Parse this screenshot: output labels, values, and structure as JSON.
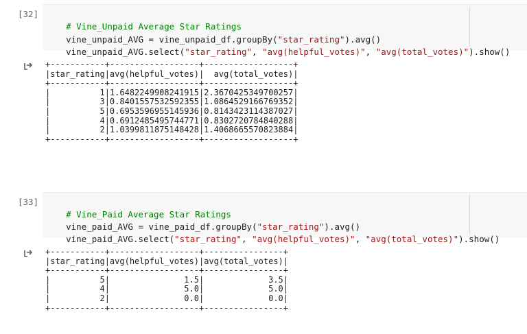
{
  "cells": [
    {
      "exec_count": "[32]",
      "code": {
        "comment": "# Vine_Unpaid Average Star Ratings",
        "line2_a": "vine_unpaid_AVG = vine_unpaid_df.groupBy(",
        "line2_str": "\"star_rating\"",
        "line2_b": ").avg()",
        "line3_a": "vine_unpaid_AVG.select(",
        "line3_s1": "\"star_rating\"",
        "line3_sep1": ", ",
        "line3_s2": "\"avg(helpful_votes)\"",
        "line3_sep2": ", ",
        "line3_s3": "\"avg(total_votes)\"",
        "line3_b": ").show()"
      },
      "output": {
        "icon": "output-arrow-icon",
        "table": {
          "columns": [
            "star_rating",
            "avg(helpful_votes)",
            "avg(total_votes)"
          ],
          "rows": [
            [
              "1",
              "1.6482249908241915",
              "2.3670425349700257"
            ],
            [
              "3",
              "0.8401557532592355",
              "1.0864529166769352"
            ],
            [
              "5",
              "0.6953596955145936",
              "0.8143423114387027"
            ],
            [
              "4",
              "0.6912485495744771",
              "0.8302720784840288"
            ],
            [
              "2",
              "1.0399811875148428",
              "1.4068665570823884"
            ]
          ]
        }
      }
    },
    {
      "exec_count": "[33]",
      "code": {
        "comment": "# Vine_Paid Average Star Ratings",
        "line2_a": "vine_paid_AVG = vine_paid_df.groupBy(",
        "line2_str": "\"star_rating\"",
        "line2_b": ").avg()",
        "line3_a": "vine_paid_AVG.select(",
        "line3_s1": "\"star_rating\"",
        "line3_sep1": ", ",
        "line3_s2": "\"avg(helpful_votes)\"",
        "line3_sep2": ", ",
        "line3_s3": "\"avg(total_votes)\"",
        "line3_b": ").show()"
      },
      "output": {
        "icon": "output-arrow-icon",
        "table": {
          "columns": [
            "star_rating",
            "avg(helpful_votes)",
            "avg(total_votes)"
          ],
          "rows": [
            [
              "5",
              "1.5",
              "3.5"
            ],
            [
              "4",
              "5.0",
              "5.0"
            ],
            [
              "2",
              "0.0",
              "0.0"
            ]
          ]
        }
      }
    }
  ]
}
